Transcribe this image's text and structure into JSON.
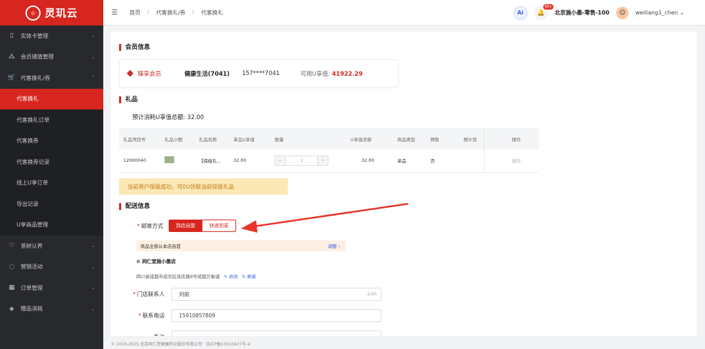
{
  "brand": {
    "logo_text": "灵玑云"
  },
  "sidebar": {
    "items": [
      {
        "label": "实体卡管理",
        "icon": "book-icon"
      },
      {
        "label": "会员储值管理",
        "icon": "org-icon"
      },
      {
        "label": "代客换礼/券",
        "icon": "cart-icon"
      },
      {
        "label": "代客换礼"
      },
      {
        "label": "代客换礼订单"
      },
      {
        "label": "代客换券"
      },
      {
        "label": "代客换券记录"
      },
      {
        "label": "线上U享订单"
      },
      {
        "label": "导出记录"
      },
      {
        "label": "U享商品管理"
      },
      {
        "label": "茶树认养",
        "icon": "heart-icon"
      },
      {
        "label": "营销活动",
        "icon": "bulb-icon"
      },
      {
        "label": "订单管理",
        "icon": "grid-icon"
      },
      {
        "label": "赠品消耗",
        "icon": "box-icon"
      }
    ]
  },
  "header": {
    "breadcrumb": [
      "首页",
      "代客换礼/券",
      "代客换礼"
    ],
    "ai": "Ai",
    "badge": "99+",
    "store": "北京施小墨-零售-100",
    "user": "weiliang1_chen"
  },
  "member": {
    "section": "会员信息",
    "level": "臻享会员",
    "name": "健康生活(7041)",
    "phone": "157****7041",
    "balance_label": "可用U享值:",
    "balance": "41922.29"
  },
  "gift": {
    "section": "礼品",
    "total": "预计消耗U享值总额: 32.00",
    "columns": [
      "礼品项目号",
      "礼品小图",
      "礼品名称",
      "单品U享值",
      "数量",
      "U享值总额",
      "商品类型",
      "预售",
      "预计到",
      "操作"
    ],
    "row": {
      "id": "12000040",
      "name": "【保级礼...",
      "unit": "32.00",
      "qty": "1",
      "sum": "32.00",
      "type": "单品",
      "presale": "否",
      "action": "删除",
      "minus": "−",
      "plus": "+"
    }
  },
  "tip": "当前用户保级成功，可0U领取当前保级礼品",
  "delivery": {
    "section": "配送信息",
    "mail_label": "邮寄方式",
    "opt1": "到店自提",
    "opt2": "快递到家",
    "pickup_note": "商品全部从本店自提",
    "adjust": "调整 ›",
    "shop": "同仁堂施小墨店",
    "address": "四川省成都市成华区双庆路8号成都万象城",
    "edit": "✎ 修改",
    "refresh": "↻ 刷新",
    "contact_label": "门店联系人",
    "contact": "刘丽",
    "contact_count": "2/20",
    "tel_label": "联系电话",
    "tel": "15910857809",
    "remark_label": "备注"
  },
  "footer": "© 2019-2025 北京同仁堂健康药业股份有限公司 · 京ICP备13010437号-4",
  "colors": {
    "accent": "#d7261f",
    "sidebar": "#28292d"
  }
}
